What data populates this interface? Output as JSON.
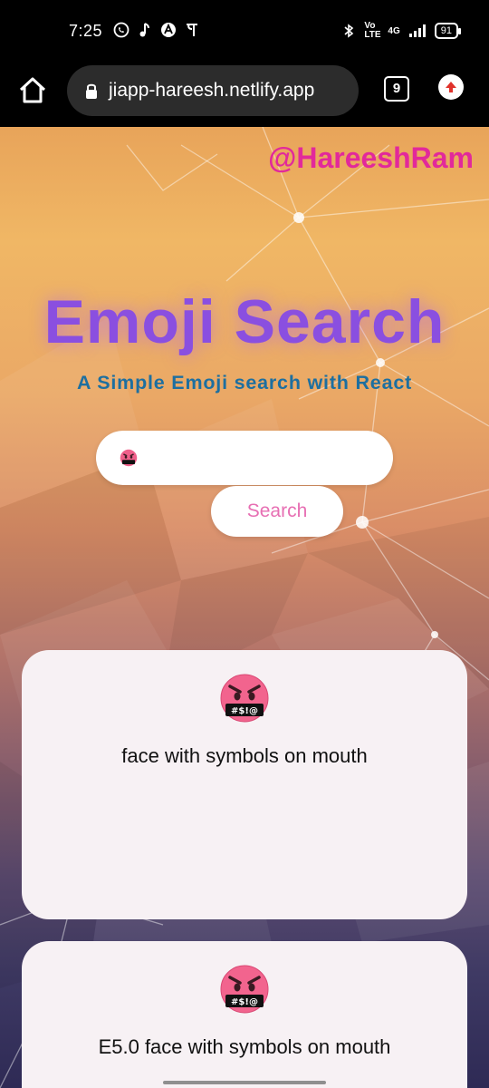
{
  "status_bar": {
    "time": "7:25",
    "battery": "91",
    "network": "4G",
    "volte": "Vo LTE",
    "left_icons": [
      "whatsapp-icon",
      "music-note-icon",
      "app-icon",
      "phonepe-icon"
    ],
    "right_icons": [
      "bluetooth-icon",
      "volte-icon",
      "signal-icon",
      "battery-icon"
    ]
  },
  "browser": {
    "url": "jiapp-hareesh.netlify.app",
    "tab_count": "9",
    "icons": [
      "home-icon",
      "lock-icon",
      "tabs-icon",
      "update-icon"
    ]
  },
  "page": {
    "handle": "@HareeshRam",
    "title": "Emoji Search",
    "subtitle": "A Simple Emoji search with React",
    "search_button": "Search",
    "input_value_emoji": "face-with-symbols-on-mouth",
    "results": [
      {
        "emoji": "face-with-symbols-on-mouth",
        "name": "face with symbols on mouth"
      },
      {
        "emoji": "face-with-symbols-on-mouth",
        "name": "E5.0 face with symbols on mouth"
      }
    ]
  },
  "colors": {
    "handle": "#e2299b",
    "title": "#8a4fe0",
    "subtitle": "#1d6fa0",
    "search_text": "#e76fb3",
    "card_bg": "#f7f1f4"
  }
}
